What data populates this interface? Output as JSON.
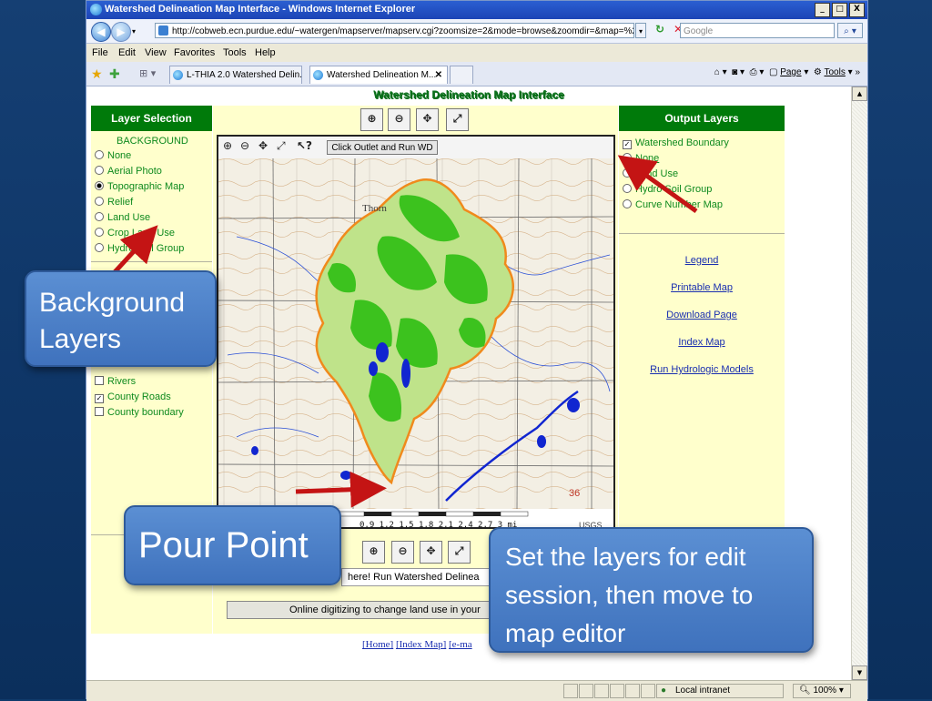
{
  "window": {
    "title": "Watershed Delineation Map Interface - Windows Internet Explorer",
    "min_btn": "_",
    "max_btn": "□",
    "close_btn": "X"
  },
  "address": {
    "url": "http://cobweb.ecn.purdue.edu/~watergen/mapserver/mapserv.cgi?zoomsize=2&mode=browse&zoomdir=&map=%2Fl",
    "search_placeholder": "Google"
  },
  "menu": [
    "File",
    "Edit",
    "View",
    "Favorites",
    "Tools",
    "Help"
  ],
  "tabs": [
    {
      "label": "L-THIA 2.0 Watershed Delin..."
    },
    {
      "label": "Watershed Delineation M..."
    }
  ],
  "commandbar": {
    "page": "Page",
    "tools": "Tools"
  },
  "page": {
    "title": "Watershed Delineation Map Interface",
    "layer_selection": {
      "heading": "Layer Selection",
      "background_label": "BACKGROUND",
      "background_options": [
        {
          "label": "None",
          "selected": false
        },
        {
          "label": "Aerial Photo",
          "selected": false
        },
        {
          "label": "Topographic Map",
          "selected": true
        },
        {
          "label": "Relief",
          "selected": false
        },
        {
          "label": "Land Use",
          "selected": false
        },
        {
          "label": "Crop Land Use",
          "selected": false
        },
        {
          "label": "Hydro Soil Group",
          "selected": false
        }
      ],
      "overlay_options": [
        {
          "label": "Rivers",
          "checked": false
        },
        {
          "label": "County Roads",
          "checked": true
        },
        {
          "label": "County boundary",
          "checked": false
        }
      ]
    },
    "map": {
      "click_outlet_button": "Click Outlet and Run WD",
      "scale_text": "0.9  1.2  1.5  1.8  2.1  2.4  2.7   3 mi",
      "map_label_usgs": "USGS",
      "map_label_36": "36",
      "map_label_thorn": "Thorn"
    },
    "bottom_banner": "here! Run Watershed Delinea",
    "digitize_button": "Online digitizing to change land use in your",
    "footer_links": [
      "[Home]",
      "[Index Map]",
      "[e-ma"
    ],
    "output_layers": {
      "heading": "Output Layers",
      "watershed_boundary": {
        "label": "Watershed Boundary",
        "checked": true
      },
      "options": [
        {
          "label": "None",
          "selected": false
        },
        {
          "label": "Land Use",
          "selected": false
        },
        {
          "label": "Hydro Soil Group",
          "selected": false
        },
        {
          "label": "Curve Number Map",
          "selected": false
        }
      ],
      "links": [
        "Legend",
        "Printable Map",
        "Download Page",
        "Index Map",
        "Run Hydrologic Models"
      ]
    }
  },
  "status": {
    "zone": "Local intranet",
    "zoom": "100%"
  },
  "callouts": {
    "background_layers": "Background Layers",
    "pour_point": "Pour Point",
    "set_layers": "Set the layers for edit session, then move to map editor"
  },
  "colors": {
    "panel_green": "#007a0a",
    "panel_bg": "#ffffcc",
    "callout_blue": "#4a7fc8",
    "arrow_red": "#c41414",
    "watershed_fill": "#b8e07a",
    "watershed_green": "#3cc21e",
    "watershed_boundary": "#f08a1c",
    "water_blue": "#1126d0"
  }
}
